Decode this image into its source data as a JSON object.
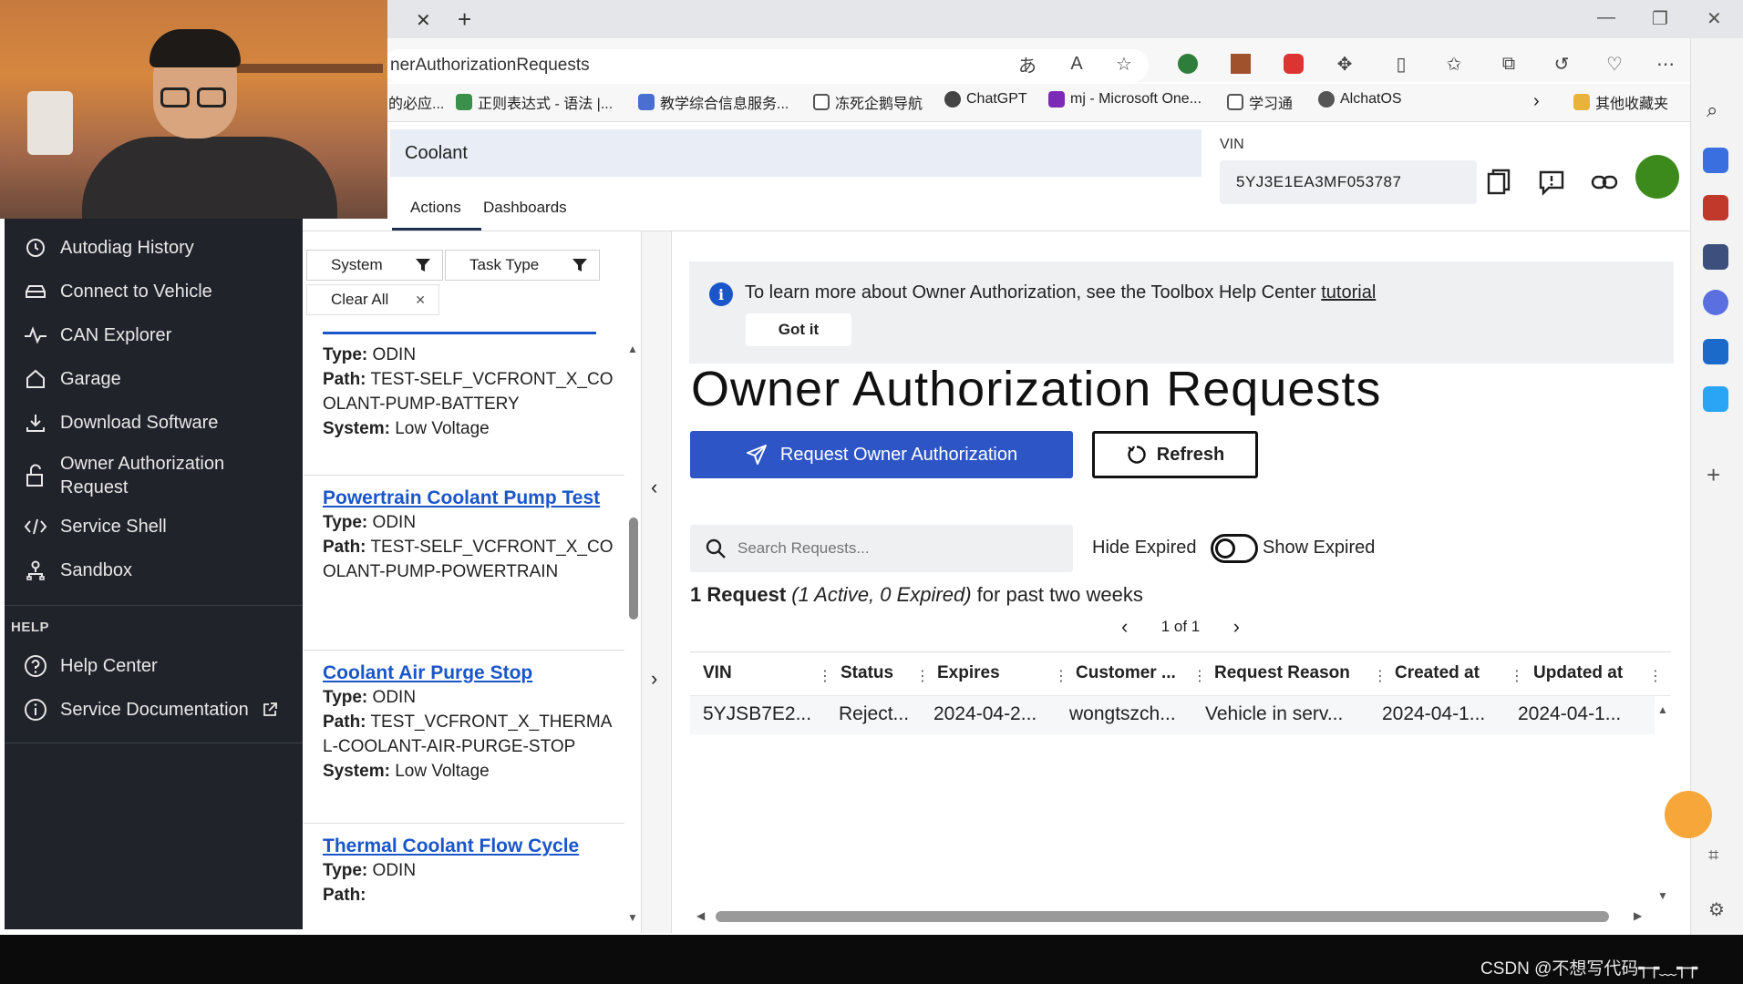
{
  "browser": {
    "url": "nerAuthorizationRequests",
    "bookmarks": [
      {
        "label": "的必应..."
      },
      {
        "label": "正则表达式 - 语法 |..."
      },
      {
        "label": "教学综合信息服务..."
      },
      {
        "label": "冻死企鹅导航"
      },
      {
        "label": "ChatGPT"
      },
      {
        "label": "mj - Microsoft One..."
      },
      {
        "label": "学习通"
      },
      {
        "label": "AlchatOS"
      },
      {
        "label": "其他收藏夹"
      }
    ]
  },
  "header": {
    "search_value": "Coolant",
    "vin_label": "VIN",
    "vin_value": "5YJ3E1EA3MF053787",
    "tabs": [
      {
        "label": "Actions"
      },
      {
        "label": "Dashboards"
      }
    ]
  },
  "sidebar": {
    "items": [
      {
        "label": "Autodiag History"
      },
      {
        "label": "Connect to Vehicle"
      },
      {
        "label": "CAN Explorer"
      },
      {
        "label": "Garage"
      },
      {
        "label": "Download Software"
      },
      {
        "label": "Owner Authorization Request"
      },
      {
        "label": "Service Shell"
      },
      {
        "label": "Sandbox"
      }
    ],
    "help_heading": "HELP",
    "help_items": [
      {
        "label": "Help Center"
      },
      {
        "label": "Service Documentation"
      }
    ]
  },
  "filters": {
    "system": "System",
    "task_type": "Task Type",
    "clear_all": "Clear All"
  },
  "routines": [
    {
      "title": "",
      "type_label": "Type:",
      "type": "ODIN",
      "path_label": "Path:",
      "path": "TEST-SELF_VCFRONT_X_COOLANT-PUMP-BATTERY",
      "system_label": "System:",
      "system": "Low Voltage"
    },
    {
      "title": "Powertrain Coolant Pump Test",
      "type_label": "Type:",
      "type": "ODIN",
      "path_label": "Path:",
      "path": "TEST-SELF_VCFRONT_X_COOLANT-PUMP-POWERTRAIN"
    },
    {
      "title": "Coolant Air Purge Stop",
      "type_label": "Type:",
      "type": "ODIN",
      "path_label": "Path:",
      "path": "TEST_VCFRONT_X_THERMAL-COOLANT-AIR-PURGE-STOP",
      "system_label": "System:",
      "system": "Low Voltage"
    },
    {
      "title": "Thermal Coolant Flow Cycle",
      "type_label": "Type:",
      "type": "ODIN",
      "path_label": "Path:"
    }
  ],
  "main": {
    "info_text": "To learn more about Owner Authorization, see the Toolbox Help Center",
    "info_link": "tutorial",
    "got_it": "Got it",
    "title": "Owner Authorization Requests",
    "request_button": "Request Owner Authorization",
    "refresh_button": "Refresh",
    "search_placeholder": "Search Requests...",
    "hide_expired": "Hide Expired",
    "show_expired": "Show Expired",
    "count_bold": "1 Request",
    "count_italic": "(1 Active, 0 Expired)",
    "count_rest": "for past two weeks",
    "pager": "1 of 1"
  },
  "table": {
    "columns": [
      "VIN",
      "Status",
      "Expires",
      "Customer ...",
      "Request Reason",
      "Created at",
      "Updated at"
    ],
    "rows": [
      [
        "5YJSB7E2...",
        "Reject...",
        "2024-04-2...",
        "wongtszch...",
        "Vehicle in serv...",
        "2024-04-1...",
        "2024-04-1..."
      ]
    ]
  },
  "footer": {
    "watermark": "CSDN @不想写代码┭┮﹏┭┮"
  },
  "colors": {
    "primary": "#2d55c6",
    "link": "#1a56c9",
    "nav_bg": "#20232a",
    "avatar": "#3d8a1c"
  }
}
